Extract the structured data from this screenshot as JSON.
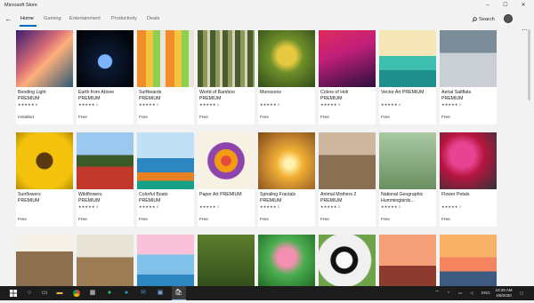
{
  "window": {
    "title": "Microsoft Store",
    "min": "–",
    "max": "☐",
    "close": "✕"
  },
  "nav": {
    "back": "←",
    "tabs": [
      "Home",
      "Gaming",
      "Entertainment",
      "Productivity",
      "Deals"
    ],
    "search_label": "Search",
    "more": "···"
  },
  "cards": [
    {
      "title": "Bending Light",
      "sub": "PREMIUM",
      "stars": "★★★★★ 6",
      "price": "Installed"
    },
    {
      "title": "Earth from Above",
      "sub": "PREMIUM",
      "stars": "★★★★★ 1",
      "price": "Free"
    },
    {
      "title": "Surfboards",
      "sub": "PREMIUM",
      "stars": "★★★★★ 1",
      "price": "Free"
    },
    {
      "title": "World of Bamboo",
      "sub": "PREMIUM",
      "stars": "★★★★★ 1",
      "price": "Free"
    },
    {
      "title": "Monsoons",
      "sub": "",
      "stars": "★★★★★ 2",
      "price": "Free"
    },
    {
      "title": "Colors of Holi",
      "sub": "PREMIUM",
      "stars": "★★★★★ 3",
      "price": "Free"
    },
    {
      "title": "Vector Art PREMIUM",
      "sub": "",
      "stars": "★★★★★ 4",
      "price": "Free"
    },
    {
      "title": "Aerial Saltflats",
      "sub": "PREMIUM",
      "stars": "★★★★★ 2",
      "price": "Free"
    },
    {
      "title": "Sunflowers",
      "sub": "PREMIUM",
      "stars": "",
      "price": "Free"
    },
    {
      "title": "Wildflowers",
      "sub": "PREMIUM",
      "stars": "★★★★★ 4",
      "price": "Free"
    },
    {
      "title": "Colorful Boats",
      "sub": "PREMIUM",
      "stars": "★★★★★ 4",
      "price": "Free"
    },
    {
      "title": "Paper Art PREMIUM",
      "sub": "",
      "stars": "★★★★★ 1",
      "price": "Free"
    },
    {
      "title": "Spiraling Fractals",
      "sub": "PREMIUM",
      "stars": "★★★★★ 2",
      "price": "Free"
    },
    {
      "title": "Animal Mothers 2",
      "sub": "PREMIUM",
      "stars": "★★★★★ 2",
      "price": "Free"
    },
    {
      "title": "National Geographic",
      "sub": "Hummingbirds...",
      "stars": "★★★★★ 2",
      "price": "Free"
    },
    {
      "title": "Flower Petals",
      "sub": "",
      "stars": "★★★★★ 1",
      "price": "Free"
    },
    {
      "title": "",
      "sub": "",
      "stars": "",
      "price": ""
    },
    {
      "title": "",
      "sub": "",
      "stars": "",
      "price": ""
    },
    {
      "title": "",
      "sub": "",
      "stars": "",
      "price": ""
    },
    {
      "title": "",
      "sub": "",
      "stars": "",
      "price": ""
    },
    {
      "title": "",
      "sub": "",
      "stars": "",
      "price": ""
    },
    {
      "title": "",
      "sub": "",
      "stars": "",
      "price": ""
    },
    {
      "title": "",
      "sub": "",
      "stars": "",
      "price": ""
    },
    {
      "title": "",
      "sub": "",
      "stars": "",
      "price": ""
    }
  ],
  "taskbar": {
    "time": "10:25 AM",
    "date": "4/9/2020",
    "lang": "ENG"
  }
}
